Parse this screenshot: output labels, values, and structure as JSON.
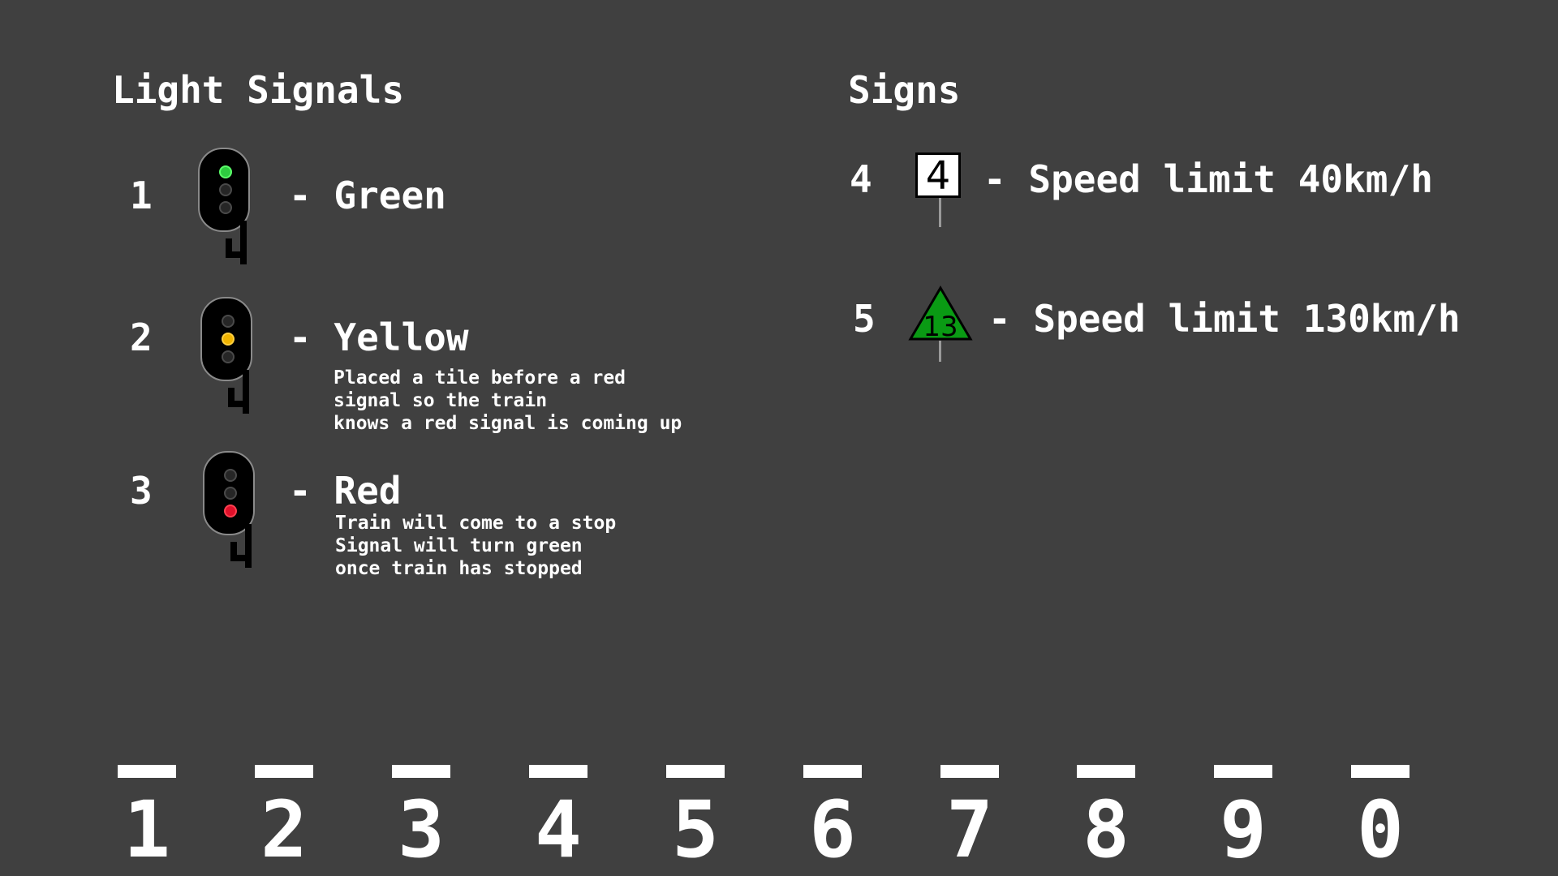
{
  "light_signals": {
    "heading": "Light Signals",
    "items": [
      {
        "number": "1",
        "label": "- Green",
        "lamp_color": "#2ecc40",
        "description": []
      },
      {
        "number": "2",
        "label": "- Yellow",
        "lamp_color": "#f0b400",
        "description": [
          "Placed a tile before a red",
          "signal so the train",
          "knows a red signal is coming up"
        ]
      },
      {
        "number": "3",
        "label": "- Red",
        "lamp_color": "#e0102a",
        "description": [
          "Train will come to a stop",
          "Signal will turn green",
          "once train has stopped"
        ]
      }
    ]
  },
  "signs": {
    "heading": "Signs",
    "items": [
      {
        "number": "4",
        "sign_text": "4",
        "label": "- Speed limit 40km/h",
        "sign_shape": "white-square"
      },
      {
        "number": "5",
        "sign_text": "13",
        "label": "- Speed limit 130km/h",
        "sign_shape": "green-triangle",
        "sign_color": "#0a9a14"
      }
    ]
  },
  "hotbar": {
    "slots": [
      "1",
      "2",
      "3",
      "4",
      "5",
      "6",
      "7",
      "8",
      "9",
      "0"
    ]
  }
}
